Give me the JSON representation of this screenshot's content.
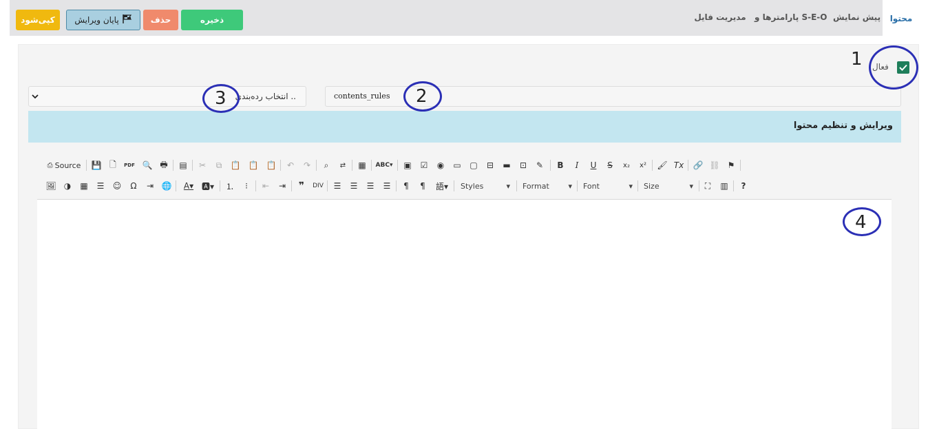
{
  "tabs": [
    {
      "label": "محتوا"
    },
    {
      "label": "پیش نمایش"
    },
    {
      "label": "پارامترها و S-E-O"
    },
    {
      "label": "مدیریت فایل"
    }
  ],
  "actions": {
    "save": "ذخیره",
    "delete": "حذف",
    "end_edit": "پایان ویرایش",
    "clone": "کپی‌شود"
  },
  "colors": {
    "save": "#3ec97a",
    "delete": "#f08a6c",
    "end_edit": "#a9cfe0",
    "clone": "#f0b90f",
    "header_strip": "#c3e6f0",
    "checkbox": "#1e7e5a",
    "annotation": "#2b2fb5"
  },
  "form": {
    "active_label": "فعال",
    "active_checked": true,
    "title_value": "contents_rules",
    "category_placeholder": "انتخاب رده‌بندی ..",
    "section_title": "ویرایش و تنظیم محتوا"
  },
  "annotations": [
    "1",
    "2",
    "3",
    "4"
  ],
  "toolbar": {
    "source_label": "Source",
    "styles_label": "Styles",
    "format_label": "Format",
    "font_label": "Font",
    "size_label": "Size",
    "help_label": "?"
  }
}
